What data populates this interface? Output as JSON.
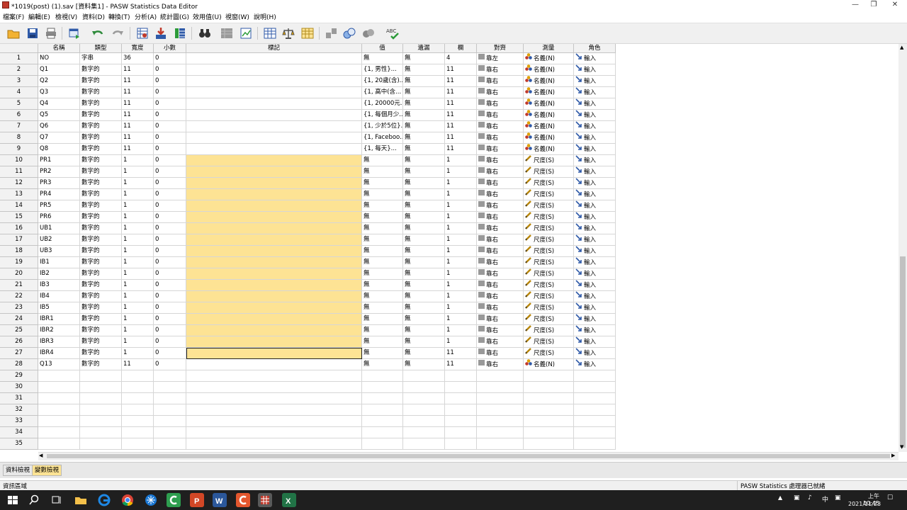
{
  "window": {
    "title": "*1019(post) (1).sav [資料集1] - PASW Statistics Data Editor"
  },
  "menu": [
    "檔案(F)",
    "編輯(E)",
    "檢視(V)",
    "資料(D)",
    "轉換(T)",
    "分析(A)",
    "統計圖(G)",
    "效用值(U)",
    "視窗(W)",
    "說明(H)"
  ],
  "columns": [
    "名稱",
    "類型",
    "寬度",
    "小數",
    "標記",
    "值",
    "遺漏",
    "欄",
    "對齊",
    "測量",
    "角色"
  ],
  "rows": [
    [
      "NO",
      "字串",
      "36",
      "0",
      "",
      "無",
      "無",
      "4",
      "靠左",
      "名義(N)",
      "輸入"
    ],
    [
      "Q1",
      "數字的",
      "11",
      "0",
      "",
      "{1, 男性}...",
      "無",
      "11",
      "靠右",
      "名義(N)",
      "輸入"
    ],
    [
      "Q2",
      "數字的",
      "11",
      "0",
      "",
      "{1, 20歲(含)...",
      "無",
      "11",
      "靠右",
      "名義(N)",
      "輸入"
    ],
    [
      "Q3",
      "數字的",
      "11",
      "0",
      "",
      "{1, 高中(含...",
      "無",
      "11",
      "靠右",
      "名義(N)",
      "輸入"
    ],
    [
      "Q4",
      "數字的",
      "11",
      "0",
      "",
      "{1, 20000元...",
      "無",
      "11",
      "靠右",
      "名義(N)",
      "輸入"
    ],
    [
      "Q5",
      "數字的",
      "11",
      "0",
      "",
      "{1, 每個月少...",
      "無",
      "11",
      "靠右",
      "名義(N)",
      "輸入"
    ],
    [
      "Q6",
      "數字的",
      "11",
      "0",
      "",
      "{1, 少於5位}...",
      "無",
      "11",
      "靠右",
      "名義(N)",
      "輸入"
    ],
    [
      "Q7",
      "數字的",
      "11",
      "0",
      "",
      "{1, Faceboo...",
      "無",
      "11",
      "靠右",
      "名義(N)",
      "輸入"
    ],
    [
      "Q8",
      "數字的",
      "11",
      "0",
      "",
      "{1, 每天}...",
      "無",
      "11",
      "靠右",
      "名義(N)",
      "輸入"
    ],
    [
      "PR1",
      "數字的",
      "1",
      "0",
      "",
      "無",
      "無",
      "1",
      "靠右",
      "尺度(S)",
      "輸入"
    ],
    [
      "PR2",
      "數字的",
      "1",
      "0",
      "",
      "無",
      "無",
      "1",
      "靠右",
      "尺度(S)",
      "輸入"
    ],
    [
      "PR3",
      "數字的",
      "1",
      "0",
      "",
      "無",
      "無",
      "1",
      "靠右",
      "尺度(S)",
      "輸入"
    ],
    [
      "PR4",
      "數字的",
      "1",
      "0",
      "",
      "無",
      "無",
      "1",
      "靠右",
      "尺度(S)",
      "輸入"
    ],
    [
      "PR5",
      "數字的",
      "1",
      "0",
      "",
      "無",
      "無",
      "1",
      "靠右",
      "尺度(S)",
      "輸入"
    ],
    [
      "PR6",
      "數字的",
      "1",
      "0",
      "",
      "無",
      "無",
      "1",
      "靠右",
      "尺度(S)",
      "輸入"
    ],
    [
      "UB1",
      "數字的",
      "1",
      "0",
      "",
      "無",
      "無",
      "1",
      "靠右",
      "尺度(S)",
      "輸入"
    ],
    [
      "UB2",
      "數字的",
      "1",
      "0",
      "",
      "無",
      "無",
      "1",
      "靠右",
      "尺度(S)",
      "輸入"
    ],
    [
      "UB3",
      "數字的",
      "1",
      "0",
      "",
      "無",
      "無",
      "1",
      "靠右",
      "尺度(S)",
      "輸入"
    ],
    [
      "IB1",
      "數字的",
      "1",
      "0",
      "",
      "無",
      "無",
      "1",
      "靠右",
      "尺度(S)",
      "輸入"
    ],
    [
      "IB2",
      "數字的",
      "1",
      "0",
      "",
      "無",
      "無",
      "1",
      "靠右",
      "尺度(S)",
      "輸入"
    ],
    [
      "IB3",
      "數字的",
      "1",
      "0",
      "",
      "無",
      "無",
      "1",
      "靠右",
      "尺度(S)",
      "輸入"
    ],
    [
      "IB4",
      "數字的",
      "1",
      "0",
      "",
      "無",
      "無",
      "1",
      "靠右",
      "尺度(S)",
      "輸入"
    ],
    [
      "IB5",
      "數字的",
      "1",
      "0",
      "",
      "無",
      "無",
      "1",
      "靠右",
      "尺度(S)",
      "輸入"
    ],
    [
      "IBR1",
      "數字的",
      "1",
      "0",
      "",
      "無",
      "無",
      "1",
      "靠右",
      "尺度(S)",
      "輸入"
    ],
    [
      "IBR2",
      "數字的",
      "1",
      "0",
      "",
      "無",
      "無",
      "1",
      "靠右",
      "尺度(S)",
      "輸入"
    ],
    [
      "IBR3",
      "數字的",
      "1",
      "0",
      "",
      "無",
      "無",
      "1",
      "靠右",
      "尺度(S)",
      "輸入"
    ],
    [
      "IBR4",
      "數字的",
      "1",
      "0",
      "",
      "無",
      "無",
      "11",
      "靠右",
      "尺度(S)",
      "輸入"
    ],
    [
      "Q13",
      "數字的",
      "11",
      "0",
      "",
      "無",
      "無",
      "11",
      "靠右",
      "名義(N)",
      "輸入"
    ]
  ],
  "total_rows": 35,
  "highlighted_label_rows": [
    10,
    27
  ],
  "selected_cell": {
    "row": 27,
    "column": "標記"
  },
  "tabs": {
    "data_view": "資料檢視",
    "variable_view": "變數檢視",
    "active": "變數檢視"
  },
  "status": {
    "left": "資訊區域",
    "right": "PASW Statistics 處理器已就緒"
  },
  "taskbar": {
    "time": "上午 10:45",
    "date": "2021/11/23",
    "ime": "中"
  },
  "colors": {
    "highlight": "#fde394",
    "header_bg": "#f2f2f2",
    "taskbar": "#1f1f1f"
  }
}
